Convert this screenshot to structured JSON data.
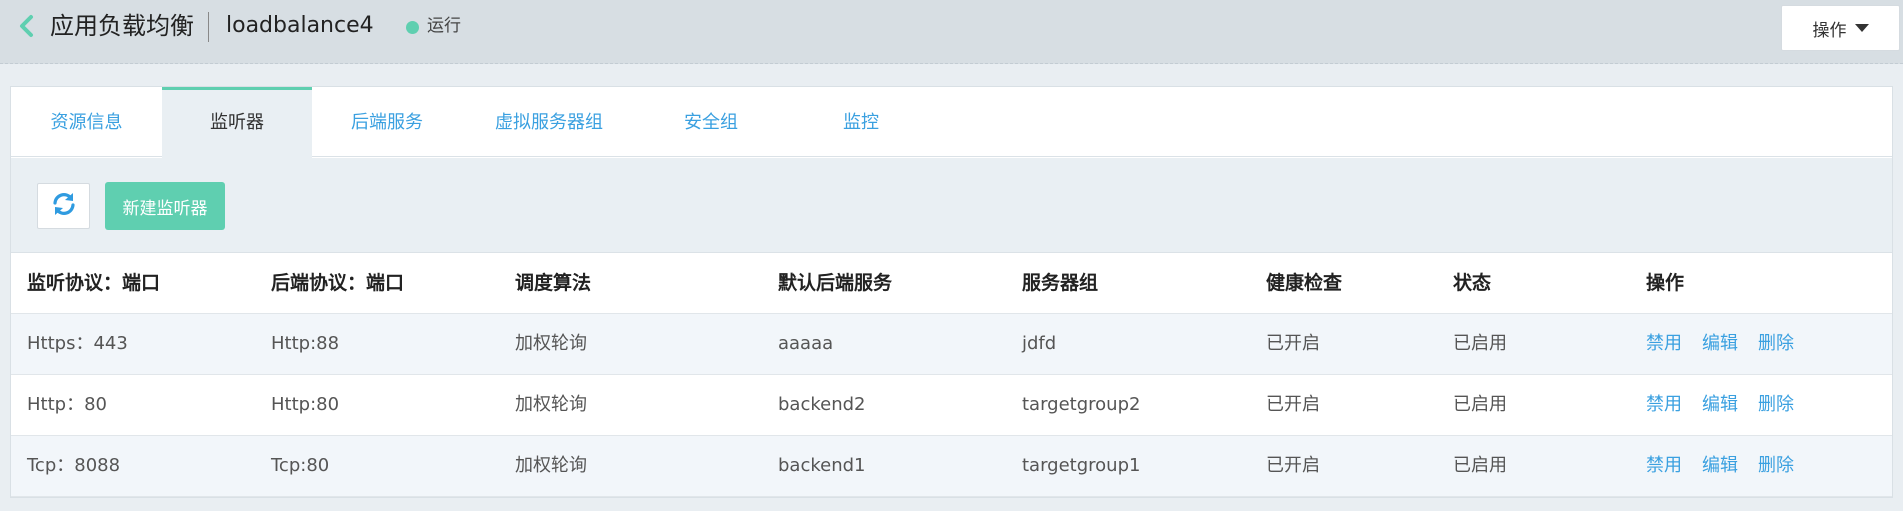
{
  "header": {
    "title": "应用负载均衡",
    "instance_name": "loadbalance4",
    "status": "运行",
    "ops_label": "操作"
  },
  "colors": {
    "accent": "#5fcfb0",
    "link": "#3aa0e0",
    "header_bg": "#d7dee3"
  },
  "icons": {
    "back": "chevron-left-icon",
    "refresh": "refresh-icon",
    "caret": "caret-down-icon"
  },
  "tabs": [
    {
      "label": "资源信息",
      "active": false
    },
    {
      "label": "监听器",
      "active": true
    },
    {
      "label": "后端服务",
      "active": false
    },
    {
      "label": "虚拟服务器组",
      "active": false
    },
    {
      "label": "安全组",
      "active": false
    },
    {
      "label": "监控",
      "active": false
    }
  ],
  "toolbar": {
    "new_label": "新建监听器"
  },
  "table": {
    "columns": [
      "监听协议：端口",
      "后端协议：端口",
      "调度算法",
      "默认后端服务",
      "服务器组",
      "健康检查",
      "状态",
      "操作"
    ],
    "rows": [
      {
        "listener": "Https：443",
        "backend_protocol": "Http:88",
        "algorithm": "加权轮询",
        "default_backend": "aaaaa",
        "server_group": "jdfd",
        "health_check": "已开启",
        "status": "已启用",
        "actions": [
          "禁用",
          "编辑",
          "删除"
        ]
      },
      {
        "listener": "Http：80",
        "backend_protocol": "Http:80",
        "algorithm": "加权轮询",
        "default_backend": "backend2",
        "server_group": "targetgroup2",
        "health_check": "已开启",
        "status": "已启用",
        "actions": [
          "禁用",
          "编辑",
          "删除"
        ]
      },
      {
        "listener": "Tcp：8088",
        "backend_protocol": "Tcp:80",
        "algorithm": "加权轮询",
        "default_backend": "backend1",
        "server_group": "targetgroup1",
        "health_check": "已开启",
        "status": "已启用",
        "actions": [
          "禁用",
          "编辑",
          "删除"
        ]
      }
    ]
  }
}
